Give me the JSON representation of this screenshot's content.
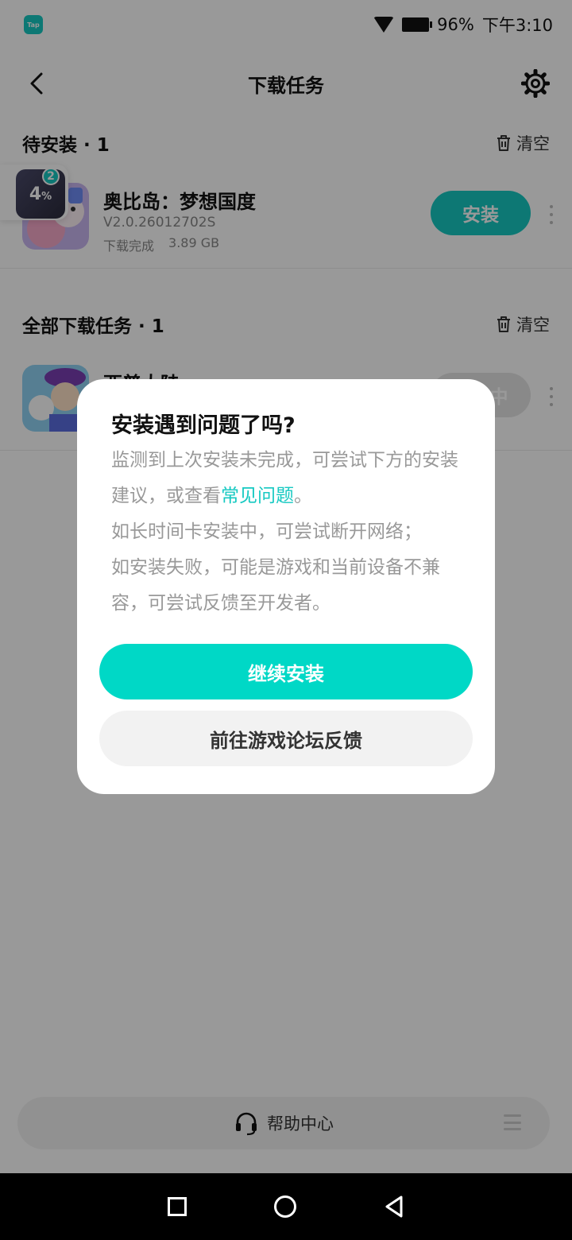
{
  "status_bar": {
    "battery": "96%",
    "time": "下午3:10",
    "app_icon_text": "Tap"
  },
  "header": {
    "title": "下载任务"
  },
  "pending": {
    "title": "待安装 · 1",
    "clear_label": "清空",
    "app": {
      "name": "奥比岛：梦想国度",
      "version": "V2.0.26012702S",
      "status": "下载完成",
      "size": "3.89 GB",
      "button": "安装"
    }
  },
  "all_tasks": {
    "title": "全部下载任务 · 1",
    "clear_label": "清空",
    "app": {
      "name": "西普大陆",
      "button": "安装中"
    }
  },
  "float_badge": {
    "percent": "4",
    "percent_sign": "%",
    "count": "2"
  },
  "dialog": {
    "title": "安装遇到问题了吗?",
    "line1_pre": "监测到上次安装未完成，可尝试下方的安装建议，或查看",
    "line1_link": "常见问题",
    "line1_post": "。",
    "line2": "如长时间卡安装中，可尝试断开网络；",
    "line3": "如安装失败，可能是游戏和当前设备不兼容，可尝试反馈至开发者。",
    "primary_button": "继续安装",
    "secondary_button": "前往游戏论坛反馈"
  },
  "footer": {
    "help_label": "帮助中心"
  },
  "colors": {
    "accent": "#16c9c2",
    "primary_button": "#00d8c6",
    "overlay": "rgba(0,0,0,0.40)"
  }
}
